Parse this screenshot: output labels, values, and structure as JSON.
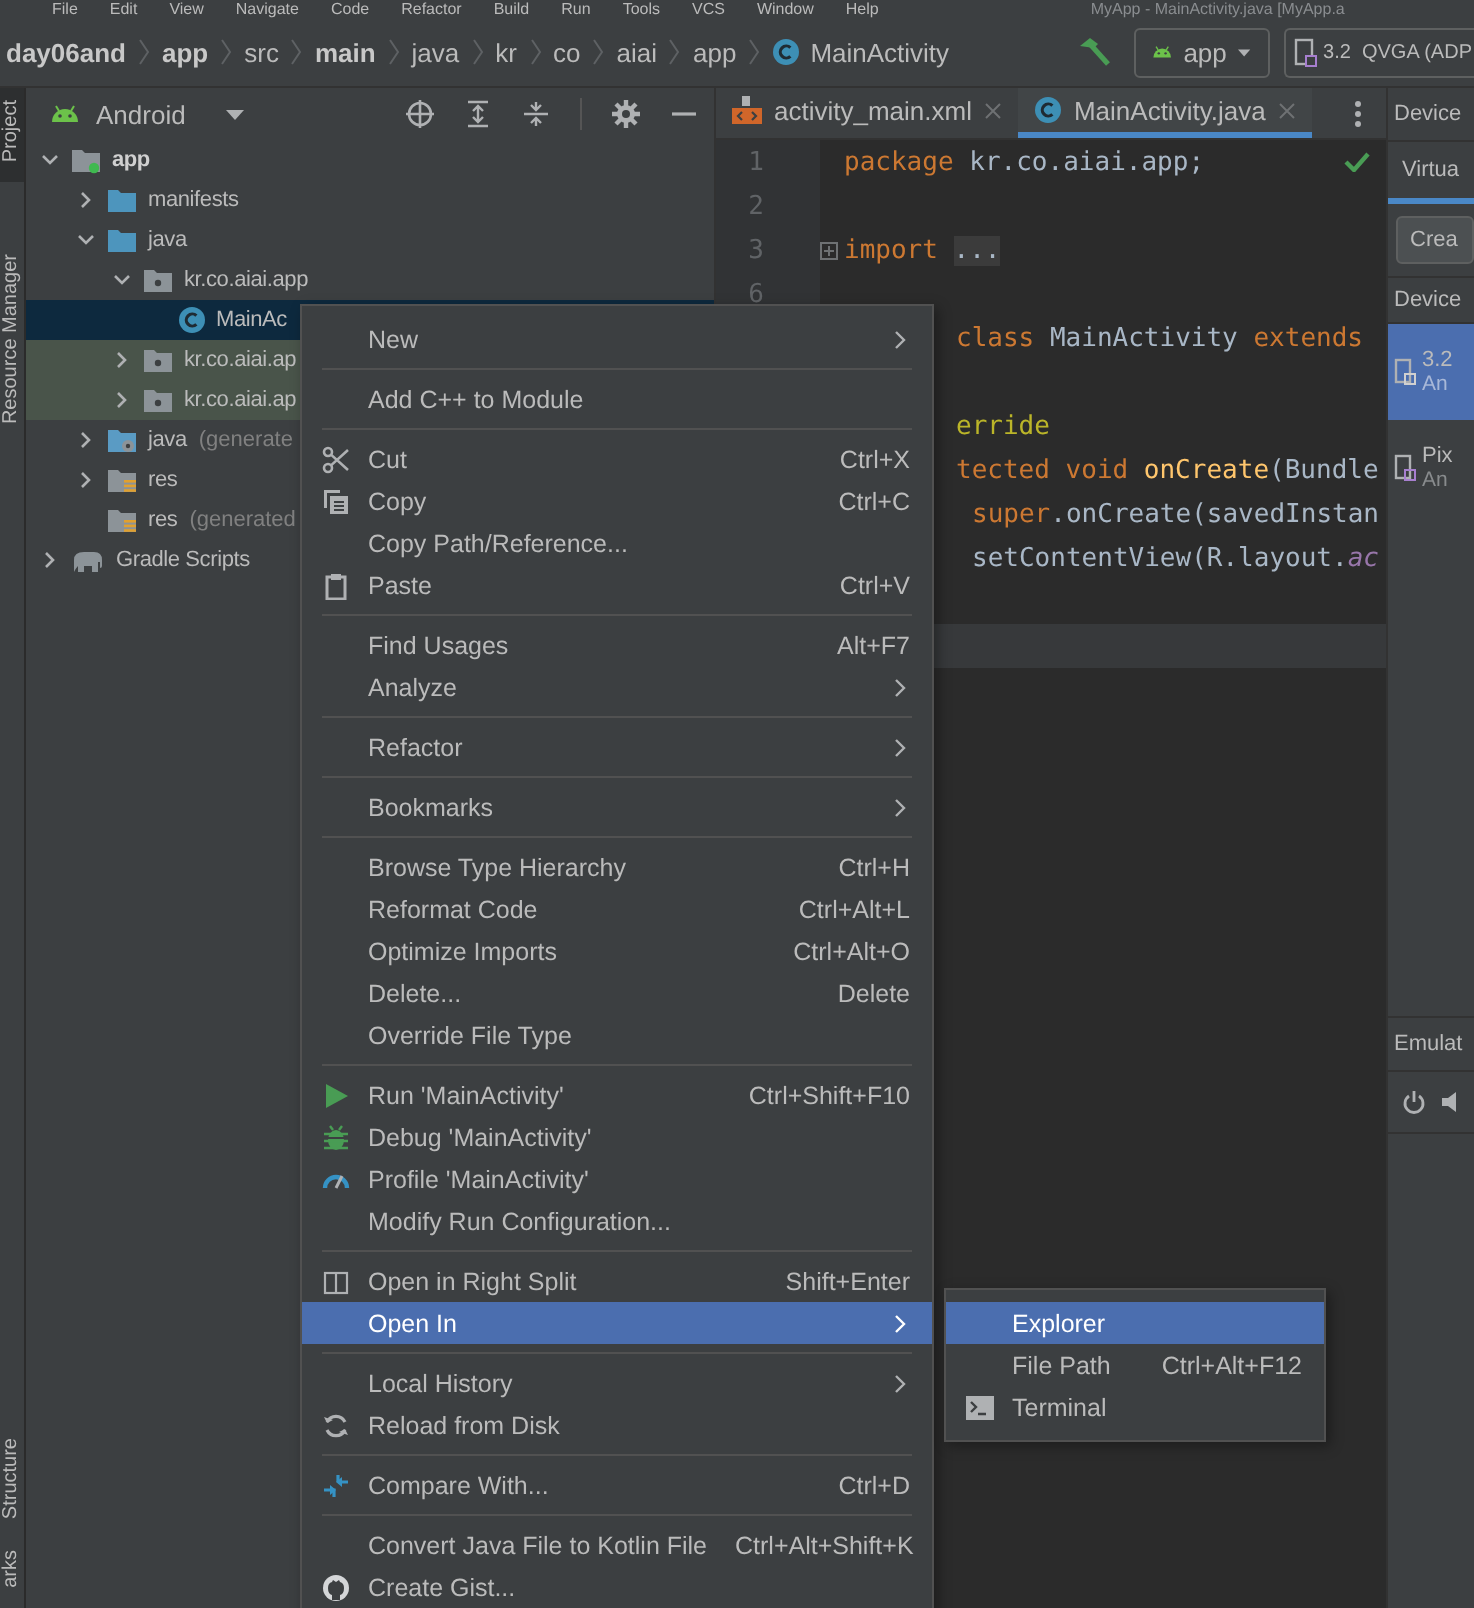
{
  "menubar": {
    "items": [
      "File",
      "Edit",
      "View",
      "Navigate",
      "Code",
      "Refactor",
      "Build",
      "Run",
      "Tools",
      "VCS",
      "Window",
      "Help"
    ],
    "title": "MyApp - MainActivity.java [MyApp.a"
  },
  "navbar": {
    "breadcrumb": [
      {
        "label": "day06and",
        "bold": true,
        "kind": "plain"
      },
      {
        "label": "app",
        "bold": true,
        "kind": "plain"
      },
      {
        "label": "src",
        "bold": false,
        "kind": "plain"
      },
      {
        "label": "main",
        "bold": true,
        "kind": "plain"
      },
      {
        "label": "java",
        "bold": false,
        "kind": "plain"
      },
      {
        "label": "kr",
        "bold": false,
        "kind": "plain"
      },
      {
        "label": "co",
        "bold": false,
        "kind": "plain"
      },
      {
        "label": "aiai",
        "bold": false,
        "kind": "plain"
      },
      {
        "label": "app",
        "bold": false,
        "kind": "plain"
      },
      {
        "label": "MainActivity",
        "bold": false,
        "kind": "class"
      }
    ],
    "run_config": "app",
    "device": "3.2  QVGA (ADP"
  },
  "tool_strip": {
    "top": [
      {
        "label": "Project",
        "selected": true
      },
      {
        "label": "Resource Manager",
        "selected": false
      }
    ],
    "bottom": [
      {
        "label": "Structure",
        "selected": false
      },
      {
        "label": "arks",
        "selected": false
      }
    ]
  },
  "project": {
    "view": "Android",
    "tree": [
      {
        "label": "app",
        "kind": "module",
        "bold": true,
        "expanded": true,
        "selected": false,
        "tinted": false,
        "children": [
          {
            "label": "manifests",
            "kind": "folder",
            "bold": false,
            "expanded": false,
            "selected": false,
            "tinted": false
          },
          {
            "label": "java",
            "kind": "folder",
            "bold": false,
            "expanded": true,
            "selected": false,
            "tinted": false,
            "children": [
              {
                "label": "kr.co.aiai.app",
                "kind": "package",
                "bold": false,
                "expanded": true,
                "selected": false,
                "tinted": false,
                "children": [
                  {
                    "label": "MainAc",
                    "kind": "class",
                    "bold": false,
                    "selected": true,
                    "tinted": false
                  }
                ]
              },
              {
                "label": "kr.co.aiai.ap",
                "kind": "package",
                "bold": false,
                "expanded": false,
                "selected": false,
                "tinted": true
              },
              {
                "label": "kr.co.aiai.ap",
                "kind": "package",
                "bold": false,
                "expanded": false,
                "selected": false,
                "tinted": true
              }
            ]
          },
          {
            "label": "java",
            "note": "(generate",
            "kind": "generated-folder",
            "bold": false,
            "expanded": false,
            "selected": false,
            "tinted": false
          },
          {
            "label": "res",
            "kind": "resource-folder",
            "bold": false,
            "expanded": false,
            "selected": false,
            "tinted": false
          },
          {
            "label": "res",
            "note": "(generated",
            "kind": "resource-folder",
            "bold": false,
            "selected": false,
            "tinted": false
          }
        ]
      },
      {
        "label": "Gradle Scripts",
        "kind": "gradle",
        "bold": false,
        "expanded": false,
        "selected": false,
        "tinted": false
      }
    ]
  },
  "editor": {
    "tabs": [
      {
        "label": "activity_main.xml",
        "kind": "xml",
        "selected": false
      },
      {
        "label": "MainActivity.java",
        "kind": "class",
        "selected": true
      }
    ],
    "inspection_ok": true,
    "lines": [
      {
        "kind": "code",
        "number": "1",
        "tokens": [
          {
            "text": "package",
            "kind": "keyword"
          },
          {
            "text": " kr.co.aiai.app;",
            "kind": "plain"
          }
        ]
      },
      {
        "kind": "blank",
        "number": "2"
      },
      {
        "kind": "code",
        "number": "3",
        "folded": true,
        "tokens": [
          {
            "text": "import",
            "kind": "keyword"
          },
          {
            "text": "...",
            "kind": "folded"
          }
        ]
      },
      {
        "kind": "blank",
        "number": "6"
      },
      {
        "kind": "code",
        "clipped": true,
        "tokens": [
          {
            "text": "class",
            "kind": "keyword"
          },
          {
            "text": " MainActivity ",
            "kind": "plain"
          },
          {
            "text": "extends",
            "kind": "keyword"
          }
        ]
      },
      {
        "kind": "blank"
      },
      {
        "kind": "code",
        "clipped": true,
        "tokens": [
          {
            "text": "erride",
            "kind": "annotation"
          }
        ]
      },
      {
        "kind": "code",
        "clipped": true,
        "tokens": [
          {
            "text": "tected void",
            "kind": "keyword"
          },
          {
            "text": "onCreate",
            "kind": "method"
          },
          {
            "text": "(Bundle",
            "kind": "plain"
          }
        ]
      },
      {
        "kind": "code",
        "clipped": true,
        "nested": true,
        "tokens": [
          {
            "text": "super",
            "kind": "keyword"
          },
          {
            "text": ".onCreate(savedInstan",
            "kind": "plain"
          }
        ]
      },
      {
        "kind": "code",
        "clipped": true,
        "nested": true,
        "tokens": [
          {
            "text": "setContentView(R.layout.",
            "kind": "plain"
          },
          {
            "text": "ac",
            "kind": "field"
          }
        ]
      },
      {
        "kind": "blank"
      },
      {
        "kind": "blank",
        "current": true
      }
    ]
  },
  "right_panel": {
    "title": "Device",
    "tabs": [
      {
        "label": "Virtua",
        "selected": true
      }
    ],
    "button": "Crea",
    "column": "Device",
    "devices": [
      {
        "name": "3.2",
        "detail": "An",
        "selected": true
      },
      {
        "name": "Pix",
        "detail": "An",
        "selected": false
      }
    ],
    "emulator_title": "Emulat"
  },
  "menu": {
    "items": [
      {
        "kind": "item",
        "label": "New",
        "submenu": true,
        "selected": false
      },
      {
        "kind": "separator"
      },
      {
        "kind": "item",
        "label": "Add C++ to Module",
        "submenu": false,
        "selected": false
      },
      {
        "kind": "separator"
      },
      {
        "kind": "item",
        "label": "Cut",
        "shortcut": "Ctrl+X",
        "submenu": false,
        "selected": false
      },
      {
        "kind": "item",
        "label": "Copy",
        "shortcut": "Ctrl+C",
        "submenu": false,
        "selected": false
      },
      {
        "kind": "item",
        "label": "Copy Path/Reference...",
        "submenu": false,
        "selected": false
      },
      {
        "kind": "item",
        "label": "Paste",
        "shortcut": "Ctrl+V",
        "submenu": false,
        "selected": false
      },
      {
        "kind": "separator"
      },
      {
        "kind": "item",
        "label": "Find Usages",
        "shortcut": "Alt+F7",
        "submenu": false,
        "selected": false
      },
      {
        "kind": "item",
        "label": "Analyze",
        "submenu": true,
        "selected": false
      },
      {
        "kind": "separator"
      },
      {
        "kind": "item",
        "label": "Refactor",
        "submenu": true,
        "selected": false
      },
      {
        "kind": "separator"
      },
      {
        "kind": "item",
        "label": "Bookmarks",
        "submenu": true,
        "selected": false
      },
      {
        "kind": "separator"
      },
      {
        "kind": "item",
        "label": "Browse Type Hierarchy",
        "shortcut": "Ctrl+H",
        "submenu": false,
        "selected": false
      },
      {
        "kind": "item",
        "label": "Reformat Code",
        "shortcut": "Ctrl+Alt+L",
        "submenu": false,
        "selected": false
      },
      {
        "kind": "item",
        "label": "Optimize Imports",
        "shortcut": "Ctrl+Alt+O",
        "submenu": false,
        "selected": false
      },
      {
        "kind": "item",
        "label": "Delete...",
        "shortcut": "Delete",
        "submenu": false,
        "selected": false
      },
      {
        "kind": "item",
        "label": "Override File Type",
        "submenu": false,
        "selected": false
      },
      {
        "kind": "separator"
      },
      {
        "kind": "item",
        "label": "Run 'MainActivity'",
        "shortcut": "Ctrl+Shift+F10",
        "submenu": false,
        "selected": false
      },
      {
        "kind": "item",
        "label": "Debug 'MainActivity'",
        "submenu": false,
        "selected": false
      },
      {
        "kind": "item",
        "label": "Profile 'MainActivity'",
        "submenu": false,
        "selected": false
      },
      {
        "kind": "item",
        "label": "Modify Run Configuration...",
        "submenu": false,
        "selected": false
      },
      {
        "kind": "separator"
      },
      {
        "kind": "item",
        "label": "Open in Right Split",
        "shortcut": "Shift+Enter",
        "submenu": false,
        "selected": false
      },
      {
        "kind": "item",
        "label": "Open In",
        "submenu": true,
        "selected": true
      },
      {
        "kind": "separator"
      },
      {
        "kind": "item",
        "label": "Local History",
        "submenu": true,
        "selected": false
      },
      {
        "kind": "item",
        "label": "Reload from Disk",
        "submenu": false,
        "selected": false
      },
      {
        "kind": "separator"
      },
      {
        "kind": "item",
        "label": "Compare With...",
        "shortcut": "Ctrl+D",
        "submenu": false,
        "selected": false
      },
      {
        "kind": "separator"
      },
      {
        "kind": "item",
        "label": "Convert Java File to Kotlin File",
        "shortcut": "Ctrl+Alt+Shift+K",
        "submenu": false,
        "selected": false
      },
      {
        "kind": "item",
        "label": "Create Gist...",
        "submenu": false,
        "selected": false
      }
    ]
  },
  "submenu": {
    "items": [
      {
        "label": "Explorer",
        "selected": true
      },
      {
        "label": "File Path",
        "shortcut": "Ctrl+Alt+F12",
        "selected": false
      },
      {
        "label": "Terminal",
        "selected": false
      }
    ]
  }
}
